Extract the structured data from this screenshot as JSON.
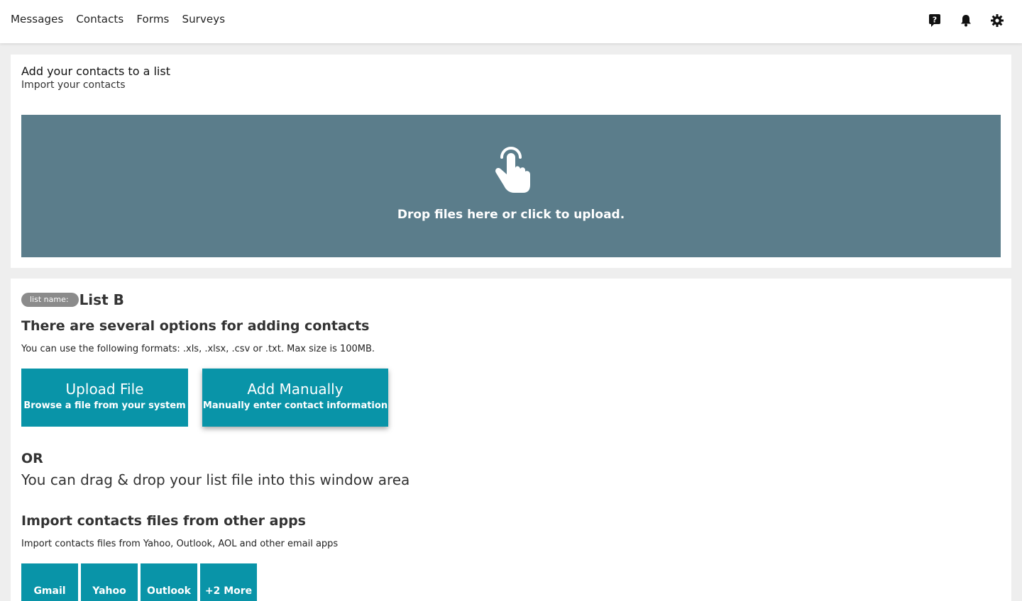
{
  "nav": {
    "items": [
      {
        "label": "Messages"
      },
      {
        "label": "Contacts"
      },
      {
        "label": "Forms"
      },
      {
        "label": "Surveys"
      }
    ],
    "icons": [
      "help-icon",
      "bell-icon",
      "gear-icon"
    ]
  },
  "import_card": {
    "title": "Add your contacts to a list",
    "subtitle": "Import your contacts",
    "dropzone_text": "Drop files here or click to upload.",
    "dropzone_icon": "hand-pointer-icon",
    "dropzone_color": "#5b7d8b"
  },
  "list_card": {
    "pill_label": "list name:",
    "list_name": "List B",
    "options_heading": "There are several options for adding contacts",
    "formats_text": "You can use the following formats: .xls, .xlsx, .csv or .txt. Max size is 100MB.",
    "upload_button": {
      "title": "Upload File",
      "subtitle": "Browse a file from your system"
    },
    "manual_button": {
      "title": "Add Manually",
      "subtitle": "Manually enter contact information"
    },
    "or_text": "OR",
    "drag_text": "You can drag & drop your list file into this window area",
    "import_heading": "Import contacts files from other apps",
    "import_subtitle": "Import contacts files from Yahoo, Outlook, AOL and other email apps",
    "apps": [
      {
        "label": "Gmail"
      },
      {
        "label": "Yahoo"
      },
      {
        "label": "Outlook"
      },
      {
        "label": "+2 More"
      }
    ],
    "accent_color": "#0994a8"
  }
}
